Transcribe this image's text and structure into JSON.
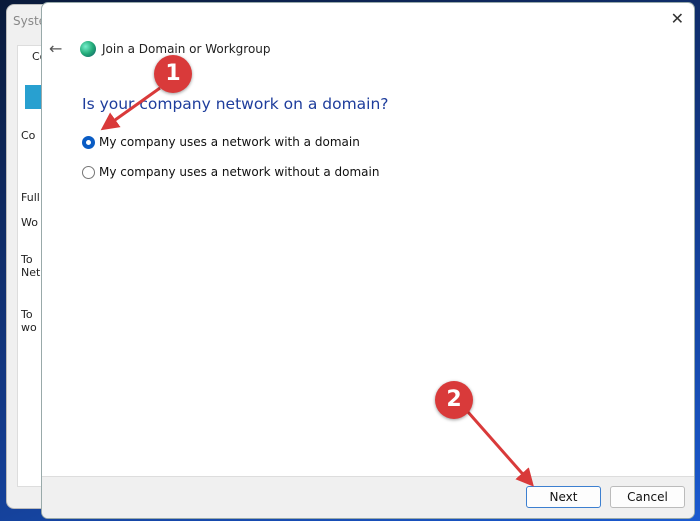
{
  "background_window": {
    "title": "Syste",
    "tab": "Comp",
    "lines": [
      "Co",
      "Full",
      "Wo",
      "To",
      "Net",
      "To",
      "wo"
    ]
  },
  "dialog": {
    "title": "Join a Domain or Workgroup",
    "question": "Is your company network on a domain?",
    "options": [
      {
        "label": "My company uses a network with a domain",
        "selected": true
      },
      {
        "label": "My company uses a network without a domain",
        "selected": false
      }
    ],
    "next_label": "Next",
    "cancel_label": "Cancel",
    "close_glyph": "✕",
    "back_glyph": "←"
  },
  "annotations": [
    {
      "number": "1"
    },
    {
      "number": "2"
    }
  ],
  "colors": {
    "accent": "#0a5cc4",
    "question": "#1e3d9c",
    "badge": "#d93a3a"
  }
}
